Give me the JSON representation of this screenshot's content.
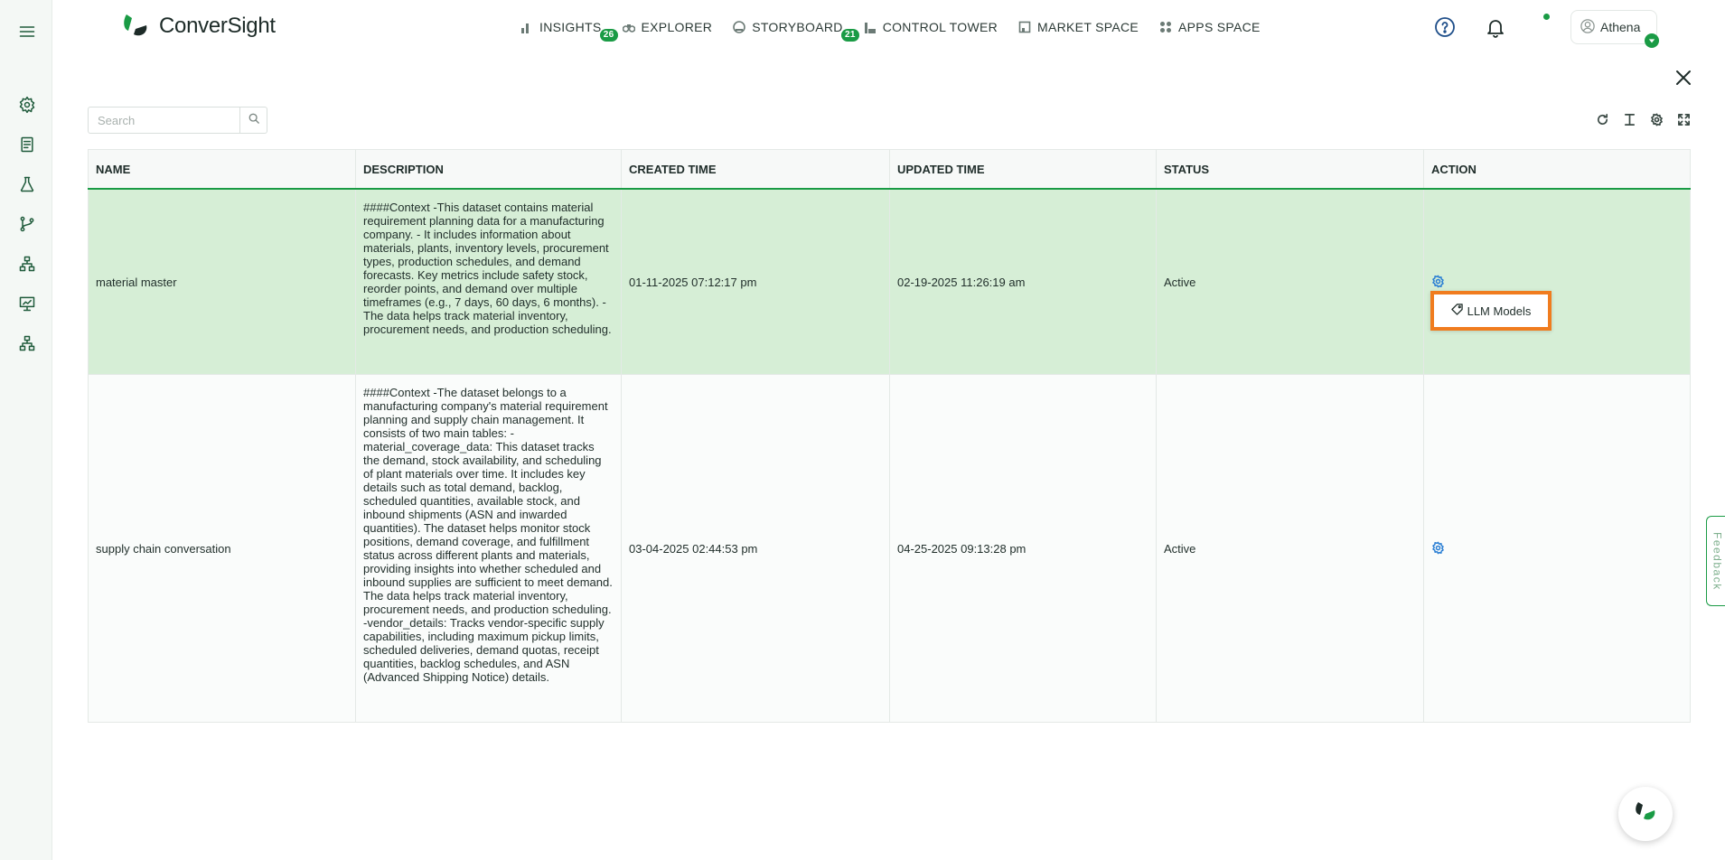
{
  "app": {
    "name": "ConverSight"
  },
  "nav": [
    {
      "label": "INSIGHTS",
      "badge": "26",
      "icon": "bar-chart-icon"
    },
    {
      "label": "EXPLORER",
      "badge": null,
      "icon": "binoculars-icon"
    },
    {
      "label": "STORYBOARD",
      "badge": "21",
      "icon": "storyboard-icon"
    },
    {
      "label": "CONTROL TOWER",
      "badge": null,
      "icon": "tower-icon"
    },
    {
      "label": "MARKET SPACE",
      "badge": null,
      "icon": "market-icon"
    },
    {
      "label": "APPS SPACE",
      "badge": null,
      "icon": "grid-icon"
    }
  ],
  "user": {
    "name": "Athena"
  },
  "search": {
    "placeholder": "Search"
  },
  "table": {
    "headers": [
      "NAME",
      "DESCRIPTION",
      "CREATED TIME",
      "UPDATED TIME",
      "STATUS",
      "ACTION"
    ],
    "rows": [
      {
        "name": "material master",
        "description": "####Context -This dataset contains material requirement planning data for a manufacturing company. - It includes information about materials, plants, inventory levels, procurement types, production schedules, and demand forecasts. Key metrics include safety stock, reorder points, and demand over multiple timeframes (e.g., 7 days, 60 days, 6 months). -The data helps track material inventory, procurement needs, and production scheduling.",
        "created": "01-11-2025 07:12:17 pm",
        "updated": "02-19-2025 11:26:19 am",
        "status": "Active"
      },
      {
        "name": "supply chain conversation",
        "description": "####Context -The dataset belongs to a manufacturing company's material requirement planning and supply chain management. It consists of two main tables: - material_coverage_data: This dataset tracks the demand, stock availability, and scheduling of plant materials over time. It includes key details such as total demand, backlog, scheduled quantities, available stock, and inbound shipments (ASN and inwarded quantities). The dataset helps monitor stock positions, demand coverage, and fulfillment status across different plants and materials, providing insights into whether scheduled and inbound supplies are sufficient to meet demand. The data helps track material inventory, procurement needs, and production scheduling. -vendor_details: Tracks vendor-specific supply capabilities, including maximum pickup limits, scheduled deliveries, demand quotas, receipt quantities, backlog schedules, and ASN (Advanced Shipping Notice) details.",
        "created": "03-04-2025 02:44:53 pm",
        "updated": "04-25-2025 09:13:28 pm",
        "status": "Active"
      }
    ]
  },
  "popup": {
    "label": "LLM Models"
  },
  "feedback": {
    "label": "Feedback"
  },
  "colors": {
    "brand": "#1a9b45",
    "selected_row": "#d6eed6",
    "highlight": "#f07c1e"
  }
}
